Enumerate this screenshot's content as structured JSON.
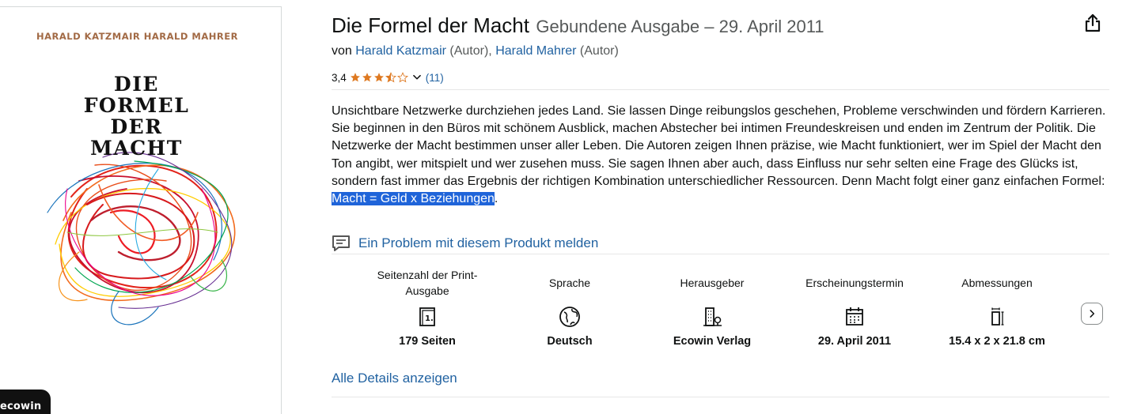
{
  "cover": {
    "authors": "HARALD KATZMAIR   HARALD MAHRER",
    "title_lines": [
      "DIE",
      "FORMEL",
      "DER",
      "MACHT"
    ],
    "publisher_badge": "ecowin"
  },
  "product": {
    "title": "Die Formel der Macht",
    "edition": "Gebundene Ausgabe – 29. April 2011",
    "byline": {
      "prefix": "von",
      "author1": "Harald Katzmair",
      "role1": "(Autor),",
      "author2": "Harald Mahrer",
      "role2": "(Autor)"
    },
    "rating": {
      "value": "3,4",
      "stars": 3.4,
      "count": "(11)",
      "star_color": "#de7921"
    },
    "description_plain": "Unsichtbare Netzwerke durchziehen jedes Land. Sie lassen Dinge reibungslos geschehen, Probleme verschwinden und fördern Karrieren. Sie beginnen in den Büros mit schönem Ausblick, machen Abstecher bei intimen Freundeskreisen und enden im Zentrum der Politik. Die Netzwerke der Macht bestimmen unser aller Leben. Die Autoren zeigen Ihnen präzise, wie Macht funktioniert, wer im Spiel der Macht den Ton angibt, wer mitspielt und wer zusehen muss. Sie sagen Ihnen aber auch, dass Einfluss nur sehr selten eine Frage des Glücks ist, sondern fast immer das Ergebnis der richtigen Kombination unterschiedlicher Ressourcen. Denn Macht folgt einer ganz einfachen Formel: ",
    "description_highlight": "Macht = Geld x Beziehungen",
    "description_end": ".",
    "report_link": "Ein Problem mit diesem Produkt melden",
    "attributes": [
      {
        "label": "Seitenzahl der Print-Ausgabe",
        "icon": "book-pages-icon",
        "value": "179 Seiten"
      },
      {
        "label": "Sprache",
        "icon": "globe-icon",
        "value": "Deutsch"
      },
      {
        "label": "Herausgeber",
        "icon": "building-icon",
        "value": "Ecowin Verlag"
      },
      {
        "label": "Erscheinungstermin",
        "icon": "calendar-icon",
        "value": "29. April 2011"
      },
      {
        "label": "Abmessungen",
        "icon": "dimensions-icon",
        "value": "15.4 x 2 x 21.8 cm"
      }
    ],
    "all_details": "Alle Details anzeigen"
  },
  "colors": {
    "link": "#2162a1",
    "highlight_bg": "#1f64d9",
    "star": "#de7921"
  }
}
